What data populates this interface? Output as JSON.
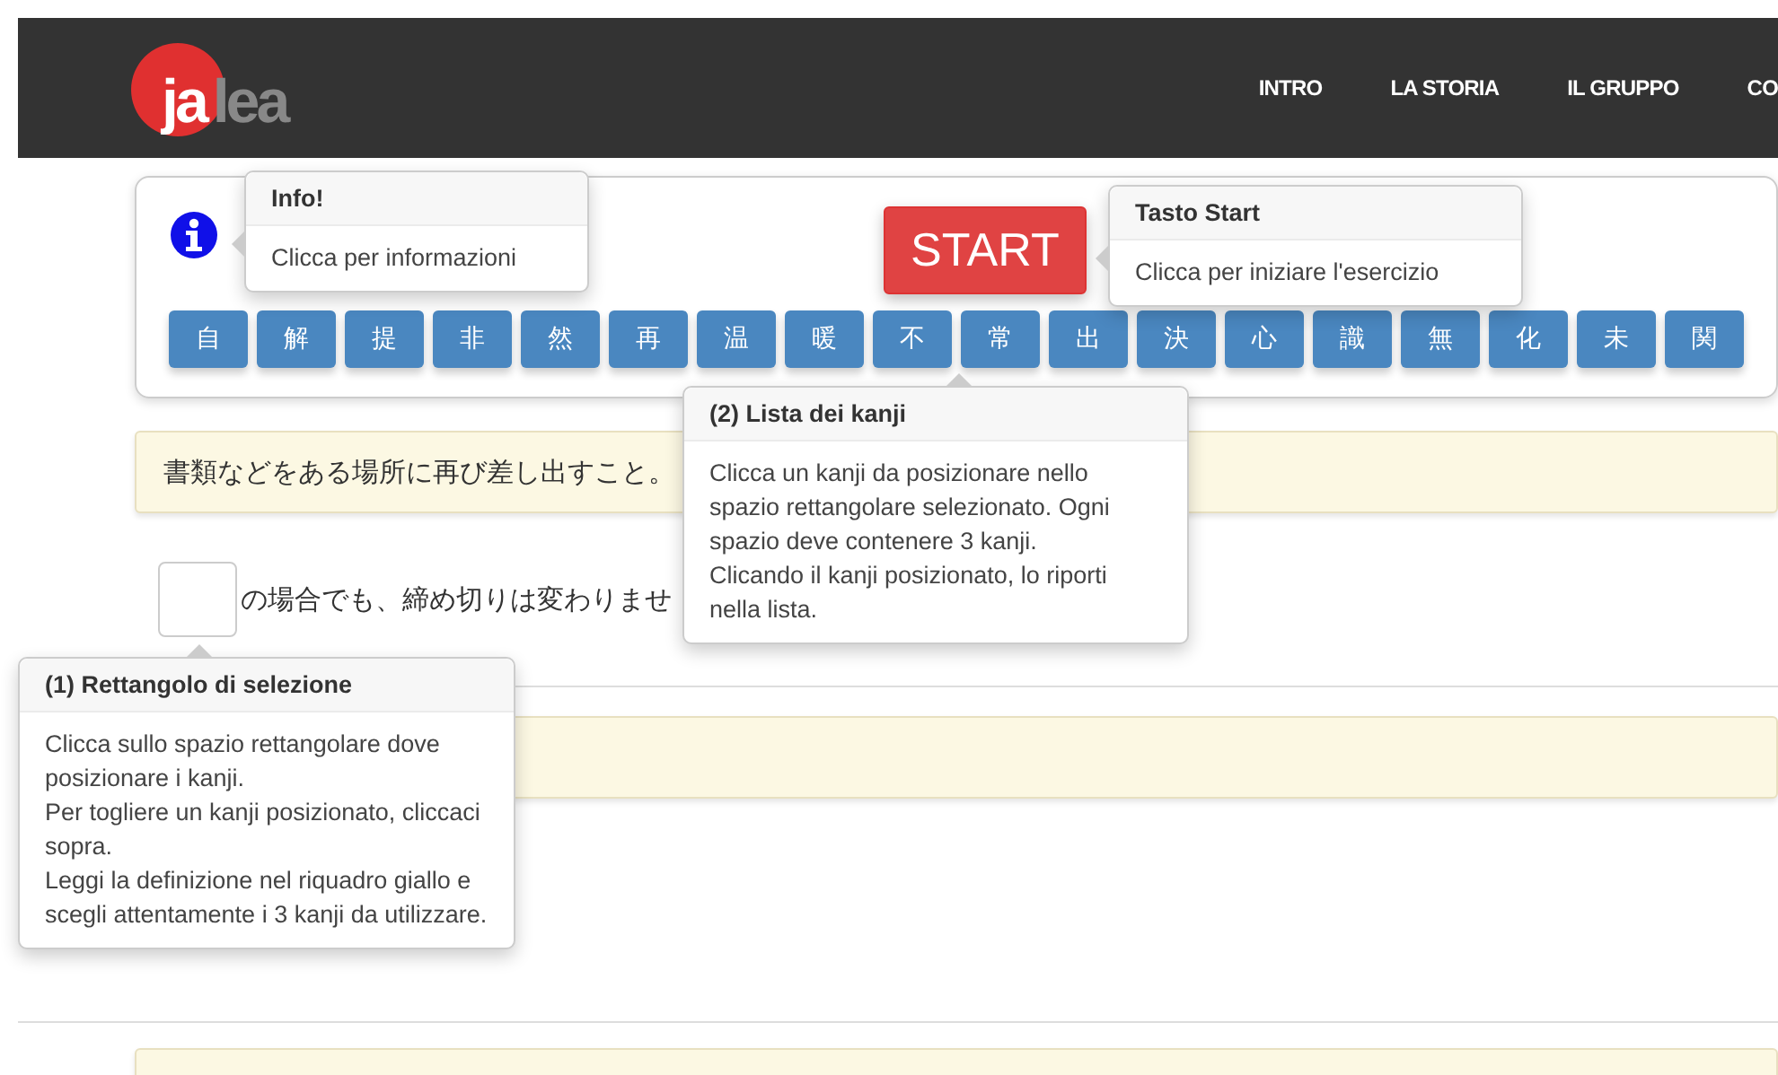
{
  "header": {
    "logo": {
      "first": "ja",
      "second": "lea"
    },
    "nav": [
      "INTRO",
      "LA STORIA",
      "IL GRUPPO",
      "CO"
    ]
  },
  "exercise": {
    "start_button": "START",
    "kanji": [
      "自",
      "解",
      "提",
      "非",
      "然",
      "再",
      "温",
      "暖",
      "不",
      "常",
      "出",
      "決",
      "心",
      "識",
      "無",
      "化",
      "未",
      "関"
    ]
  },
  "definition": "書類などをある場所に再び差し出すこと。",
  "sentence": "の場合でも、締め切りは変わりませ",
  "popovers": [
    {
      "kind": "info",
      "title": "Info!",
      "body": [
        "Clicca per informazioni"
      ]
    },
    {
      "kind": "start",
      "title": "Tasto Start",
      "body": [
        "Clicca per iniziare l'esercizio"
      ]
    },
    {
      "kind": "list",
      "title": "(2) Lista dei kanji",
      "body": [
        "Clicca un kanji da posizionare nello spazio rettangolare selezionato. Ogni spazio deve contenere 3 kanji.",
        "Clicando il kanji posizionato, lo riporti nella lista."
      ]
    },
    {
      "kind": "box",
      "title": "(1) Rettangolo di selezione",
      "body": [
        "Clicca sullo spazio rettangolare dove posizionare i kanji.",
        "Per togliere un kanji posizionato, cliccaci sopra.",
        "Leggi la definizione nel riquadro giallo e scegli attentamente i 3 kanji da utilizzare."
      ]
    }
  ]
}
